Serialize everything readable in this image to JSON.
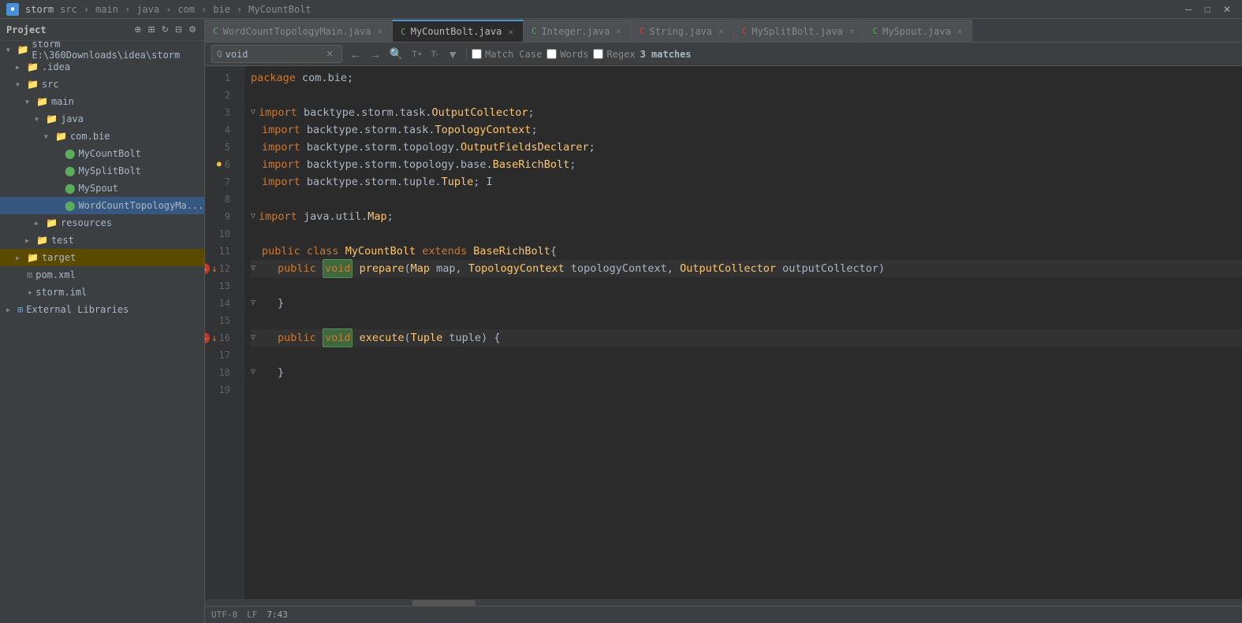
{
  "titleBar": {
    "projectName": "storm",
    "navItems": [
      "src",
      "main",
      "java",
      "com",
      "bie",
      "MyCountBolt"
    ]
  },
  "sidebar": {
    "title": "Project",
    "tree": [
      {
        "id": "storm",
        "label": "storm E:\\360Downloads\\idea\\storm",
        "indent": 1,
        "type": "project",
        "expanded": true
      },
      {
        "id": "idea",
        "label": ".idea",
        "indent": 2,
        "type": "folder",
        "expanded": false
      },
      {
        "id": "src",
        "label": "src",
        "indent": 2,
        "type": "folder",
        "expanded": true
      },
      {
        "id": "main",
        "label": "main",
        "indent": 3,
        "type": "folder",
        "expanded": true
      },
      {
        "id": "java",
        "label": "java",
        "indent": 4,
        "type": "folder",
        "expanded": true
      },
      {
        "id": "combie",
        "label": "com.bie",
        "indent": 5,
        "type": "folder",
        "expanded": true
      },
      {
        "id": "mycountbolt",
        "label": "MyCountBolt",
        "indent": 6,
        "type": "java-file"
      },
      {
        "id": "mysplitbolt",
        "label": "MySplitBolt",
        "indent": 6,
        "type": "java-file"
      },
      {
        "id": "myspout",
        "label": "MySpout",
        "indent": 6,
        "type": "java-file"
      },
      {
        "id": "wordcounttopo",
        "label": "WordCountTopologyMa...",
        "indent": 6,
        "type": "java-file",
        "active": true
      },
      {
        "id": "resources",
        "label": "resources",
        "indent": 4,
        "type": "folder",
        "expanded": false
      },
      {
        "id": "test",
        "label": "test",
        "indent": 3,
        "type": "folder",
        "expanded": false
      },
      {
        "id": "target",
        "label": "target",
        "indent": 2,
        "type": "folder",
        "expanded": false
      },
      {
        "id": "pomxml",
        "label": "pom.xml",
        "indent": 2,
        "type": "xml"
      },
      {
        "id": "stormiml",
        "label": "storm.iml",
        "indent": 2,
        "type": "iml"
      },
      {
        "id": "extlibs",
        "label": "External Libraries",
        "indent": 1,
        "type": "ext",
        "expanded": false
      }
    ]
  },
  "tabs": [
    {
      "id": "wordcount",
      "label": "WordCountTopologyMain.java",
      "active": false,
      "modified": false
    },
    {
      "id": "mycountbolt",
      "label": "MyCountBolt.java",
      "active": true,
      "modified": false
    },
    {
      "id": "integer",
      "label": "Integer.java",
      "active": false,
      "modified": false
    },
    {
      "id": "string",
      "label": "String.java",
      "active": false,
      "modified": false
    },
    {
      "id": "mysplitbolt",
      "label": "MySplitBolt.java",
      "active": false,
      "modified": false
    },
    {
      "id": "myspout",
      "label": "MySpout.java",
      "active": false,
      "modified": false
    }
  ],
  "searchBar": {
    "query": "void",
    "matchCase": false,
    "words": false,
    "regex": false,
    "matchCaseLabel": "Match Case",
    "wordsLabel": "Words",
    "regexLabel": "Regex",
    "matchesLabel": "3 matches"
  },
  "codeLines": [
    {
      "num": 1,
      "content": "package com.bie;"
    },
    {
      "num": 2,
      "content": ""
    },
    {
      "num": 3,
      "content": "import backtype.storm.task.OutputCollector;",
      "foldable": true
    },
    {
      "num": 4,
      "content": "import backtype.storm.task.TopologyContext;"
    },
    {
      "num": 5,
      "content": "import backtype.storm.topology.OutputFieldsDeclarer;"
    },
    {
      "num": 6,
      "content": "import backtype.storm.topology.base.BaseRichBolt;",
      "yellowDot": true
    },
    {
      "num": 7,
      "content": "import backtype.storm.tuple.Tuple;"
    },
    {
      "num": 8,
      "content": ""
    },
    {
      "num": 9,
      "content": "import java.util.Map;",
      "foldable": true
    },
    {
      "num": 10,
      "content": ""
    },
    {
      "num": 11,
      "content": "public class MyCountBolt extends BaseRichBolt{"
    },
    {
      "num": 12,
      "content": "    public void prepare(Map map, TopologyContext topologyContext, OutputCollector outputCollector)",
      "badge": "1",
      "foldable": true
    },
    {
      "num": 13,
      "content": ""
    },
    {
      "num": 14,
      "content": "    }",
      "foldable": true
    },
    {
      "num": 15,
      "content": ""
    },
    {
      "num": 16,
      "content": "    public void execute(Tuple tuple) {",
      "badge": "1",
      "foldable": true
    },
    {
      "num": 17,
      "content": ""
    },
    {
      "num": 18,
      "content": "    }",
      "foldable": true
    },
    {
      "num": 19,
      "content": ""
    }
  ]
}
